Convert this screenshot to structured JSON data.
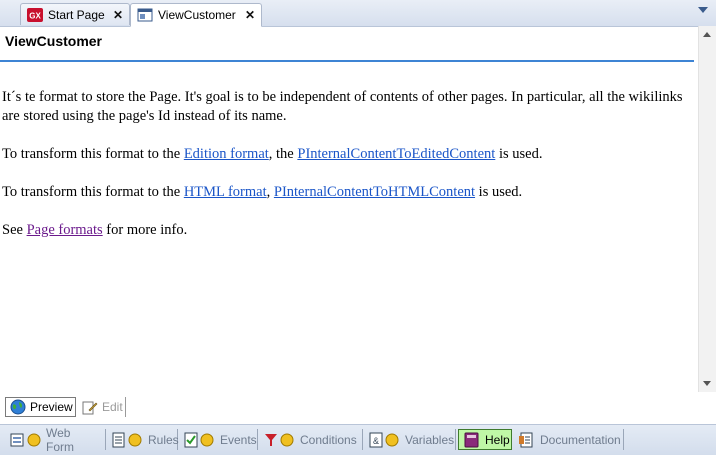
{
  "tabs": [
    {
      "label": "Start Page",
      "icon": "gx-logo-icon"
    },
    {
      "label": "ViewCustomer",
      "icon": "web-panel-icon"
    }
  ],
  "title": "ViewCustomer",
  "content": {
    "p1": "It´s te format to store the Page. It's goal is to be independent of contents of other pages. In particular, all the wikilinks are stored using the page's Id instead of its name.",
    "p2_pre": "To transform this format to the ",
    "p2_link1": "Edition format",
    "p2_mid": ", the ",
    "p2_link2": "PInternalContentToEditedContent",
    "p2_post": " is used.",
    "p3_pre": "To transform this format to the ",
    "p3_link1": "HTML format",
    "p3_mid": ", ",
    "p3_link2": "PInternalContentToHTMLContent",
    "p3_post": " is used.",
    "p4_pre": "See ",
    "p4_link": "Page formats",
    "p4_post": " for more info."
  },
  "modes": {
    "preview": "Preview",
    "edit": "Edit"
  },
  "parts": [
    {
      "label": "Web Form",
      "icon": "web-form-icon"
    },
    {
      "label": "Rules",
      "icon": "rules-icon"
    },
    {
      "label": "Events",
      "icon": "events-icon"
    },
    {
      "label": "Conditions",
      "icon": "conditions-icon"
    },
    {
      "label": "Variables",
      "icon": "variables-icon"
    },
    {
      "label": "Help",
      "icon": "help-book-icon"
    },
    {
      "label": "Documentation",
      "icon": "documentation-icon"
    }
  ],
  "colors": {
    "accent": "#3d84d4",
    "link": "#1a55c8",
    "visited_link": "#6b1a8c",
    "help_tab": "#bff7a6"
  }
}
